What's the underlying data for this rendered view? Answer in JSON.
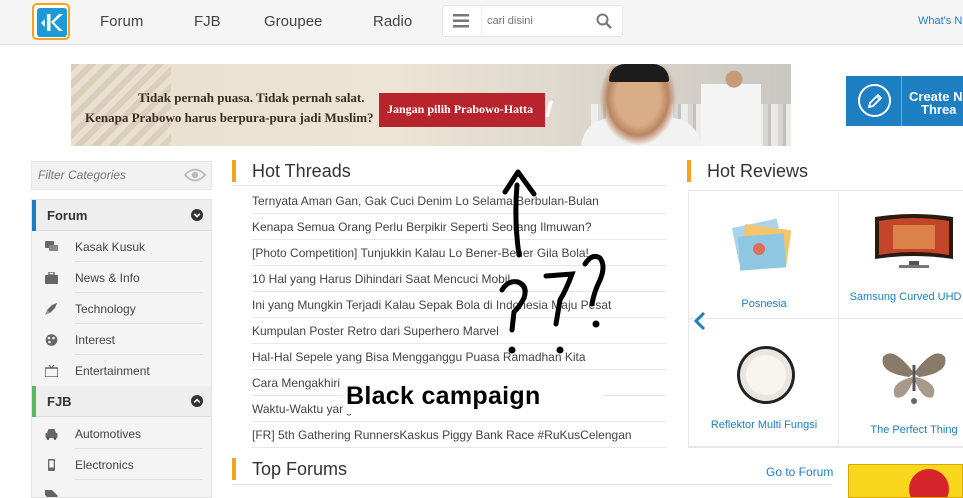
{
  "nav": {
    "links": [
      "Forum",
      "FJB",
      "Groupee",
      "Radio"
    ],
    "search_placeholder": "cari disini",
    "whats_new": "What's N",
    "brand_color": "#f7a21b",
    "accent_color": "#1d7ec1"
  },
  "banner": {
    "line1": "Tidak pernah puasa. Tidak pernah salat.",
    "line2": "Kenapa Prabowo harus berpura-pura jadi Muslim?",
    "cta": "Jangan pilih Prabowo-Hatta"
  },
  "create_thread": {
    "line1": "Create N",
    "line2": "Threa",
    "icon": "pencil-icon"
  },
  "sidebar": {
    "filter_placeholder": "Filter Categories",
    "groups": [
      {
        "label": "Forum",
        "expanded": true,
        "items": [
          {
            "label": "Kasak Kusuk",
            "icon": "chat-icon"
          },
          {
            "label": "News & Info",
            "icon": "briefcase-icon"
          },
          {
            "label": "Technology",
            "icon": "rocket-icon"
          },
          {
            "label": "Interest",
            "icon": "palette-icon"
          },
          {
            "label": "Entertainment",
            "icon": "tv-icon"
          }
        ]
      },
      {
        "label": "FJB",
        "expanded": false,
        "items": [
          {
            "label": "Automotives",
            "icon": "car-icon"
          },
          {
            "label": "Electronics",
            "icon": "phone-icon"
          }
        ]
      }
    ]
  },
  "hot_threads": {
    "title": "Hot Threads",
    "items": [
      "Ternyata Aman Gan, Gak Cuci Denim Lo Selama Berbulan-Bulan",
      "Kenapa Semua Orang Perlu Berpikir Seperti Seorang Ilmuwan?",
      "[Photo Competition] Tunjukkin Kalau Lo Bener-Bener Gila Bola!",
      "10 Hal yang Harus Dihindari Saat Mencuci Mobil",
      "Ini yang Mungkin Terjadi Kalau Sepak Bola di Indonesia Maju Pesat",
      "Kumpulan Poster Retro dari Superhero Marvel",
      "Hal-Hal Sepele yang Bisa Mengganggu Puasa Ramadhan Kita",
      "Cara Mengakhiri",
      "Waktu-Waktu yang",
      "[FR] 5th Gathering RunnersKaskus Piggy Bank Race #RuKusCelengan"
    ]
  },
  "hot_reviews": {
    "title": "Hot Reviews",
    "items": [
      {
        "name": "Posnesia"
      },
      {
        "name": "Samsung Curved UHD TV"
      },
      {
        "name": "Reflektor Multi Fungsi"
      },
      {
        "name": "The Perfect Thing"
      }
    ]
  },
  "top_forums": {
    "title": "Top Forums",
    "go_to": "Go to Forum"
  },
  "annotation": {
    "caption": "Black campaign"
  }
}
